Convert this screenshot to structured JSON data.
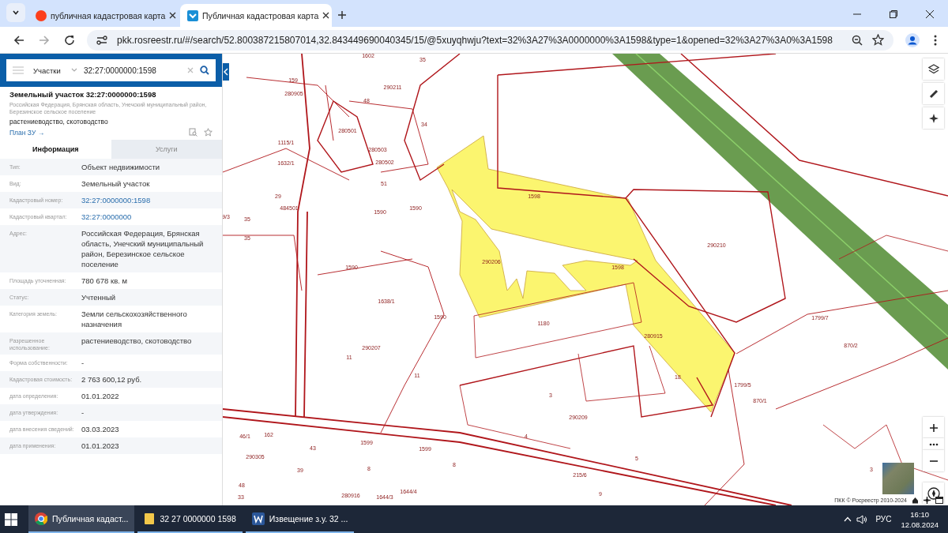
{
  "browser": {
    "tabs": [
      {
        "title": "публичная кадастровая карта",
        "selected": false
      },
      {
        "title": "Публичная кадастровая карта",
        "selected": true
      }
    ],
    "url": "pkk.rosreestr.ru/#/search/52.800387215807014,32.843449690040345/15/@5xuyqhwju?text=32%3A27%3A0000000%3A1598&type=1&opened=32%3A27%3A0%3A1598"
  },
  "panel": {
    "search": {
      "category": "Участки",
      "value": "32:27:0000000:1598"
    },
    "object": {
      "title": "Земельный участок 32:27:0000000:1598",
      "address": "Российская Федерация, Брянская область, Унечский муниципальный район, Березинское сельское поселение",
      "usage": "растениеводство, скотоводство",
      "link": "План ЗУ →"
    },
    "tabs": [
      {
        "label": "Информация",
        "selected": true
      },
      {
        "label": "Услуги",
        "selected": false
      }
    ],
    "rows": [
      {
        "label": "Тип:",
        "value": "Объект недвижимости",
        "kind": "text"
      },
      {
        "label": "Вид:",
        "value": "Земельный участок",
        "kind": "text"
      },
      {
        "label": "Кадастровый номер:",
        "value": "32:27:0000000:1598",
        "kind": "link"
      },
      {
        "label": "Кадастровый квартал:",
        "value": "32:27:0000000",
        "kind": "link"
      },
      {
        "label": "Адрес:",
        "value": "Российская Федерация, Брянская область, Унечский муниципальный район, Березинское сельское поселение",
        "kind": "text"
      },
      {
        "label": "Площадь уточненная:",
        "value": "780 678 кв. м",
        "kind": "text"
      },
      {
        "label": "Статус:",
        "value": "Учтенный",
        "kind": "text"
      },
      {
        "label": "Категория земель:",
        "value": "Земли сельскохозяйственного назначения",
        "kind": "text"
      },
      {
        "label": "Разрешенное использование:",
        "value": "растениеводство, скотоводство",
        "kind": "text"
      },
      {
        "label": "Форма собственности:",
        "value": "-",
        "kind": "text"
      },
      {
        "label": "Кадастровая стоимость:",
        "value": "2 763 600,12 руб.",
        "kind": "text"
      },
      {
        "label": "дата определения:",
        "value": "01.01.2022",
        "kind": "text"
      },
      {
        "label": "дата утверждения:",
        "value": "-",
        "kind": "text"
      },
      {
        "label": "дата внесения сведений:",
        "value": "03.03.2023",
        "kind": "text"
      },
      {
        "label": "дата применения:",
        "value": "01.01.2023",
        "kind": "text"
      }
    ]
  },
  "map": {
    "labels": [
      "1602",
      "159",
      "280905",
      "48",
      "290211",
      "35",
      "280501",
      "34",
      "280503",
      "280502",
      "1115/1",
      "1632/1",
      "29",
      "484501",
      "1590",
      "1590",
      "9/3",
      "35",
      "35",
      "1598",
      "290206",
      "1598",
      "290210",
      "1590",
      "1590",
      "1638/1",
      "1180",
      "280915",
      "290207",
      "11",
      "11",
      "1799/7",
      "870/2",
      "3",
      "18",
      "1799/5",
      "290209",
      "870/1",
      "4",
      "1599",
      "1599",
      "43",
      "46/1",
      "162",
      "290305",
      "39",
      "8",
      "8",
      "5",
      "215/6",
      "9",
      "280916",
      "1644/3",
      "1644/4",
      "48",
      "33",
      "3",
      "51"
    ],
    "attribution": "ПКК © Росреестр 2010-2024"
  },
  "taskbar": {
    "items": [
      {
        "label": "Публичная кадаст...",
        "selected": true
      },
      {
        "label": "32 27 0000000 1598",
        "selected": false
      },
      {
        "label": "Извещение з.у. 32 ...",
        "selected": false
      }
    ],
    "language": "РУС",
    "time": "16:10",
    "date": "12.08.2024"
  }
}
